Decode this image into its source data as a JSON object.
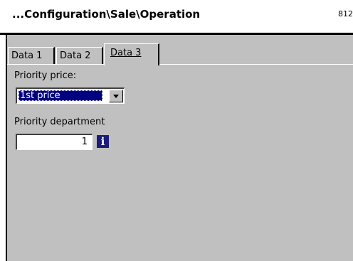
{
  "header": {
    "title": "...Configuration\\Sale\\Operation",
    "code": "812"
  },
  "tabs": [
    {
      "label": "Data 1"
    },
    {
      "label": "Data 2"
    },
    {
      "label": "Data 3"
    }
  ],
  "form": {
    "priority_price_label": "Priority price:",
    "priority_price_value": "1st price",
    "priority_department_label": "Priority department",
    "priority_department_value": "1",
    "info_glyph": "i"
  },
  "icons": {
    "dropdown": "chevron-down-icon",
    "info": "info-icon"
  },
  "colors": {
    "panel": "#c0c0c0",
    "selection": "#000080",
    "info_bg": "#1c1c7a"
  }
}
